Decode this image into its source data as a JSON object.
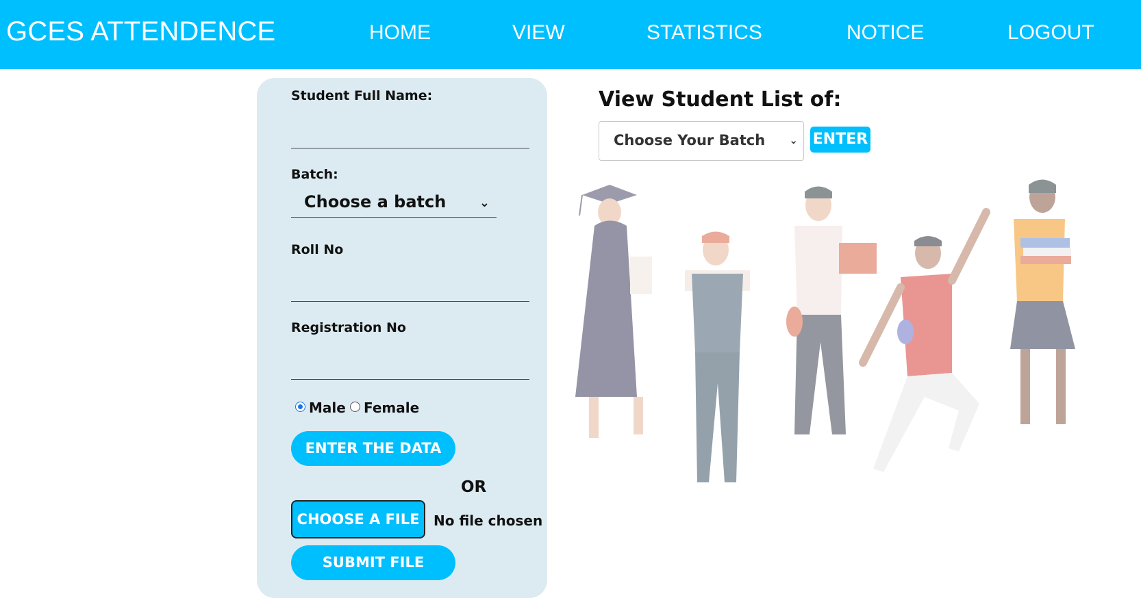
{
  "navbar": {
    "brand": "GCES ATTENDENCE",
    "links": [
      "HOME",
      "VIEW",
      "STATISTICS",
      "NOTICE",
      "LOGOUT"
    ]
  },
  "form": {
    "name_label": "Student Full Name:",
    "name_value": "",
    "batch_label": "Batch:",
    "batch_selected": "Choose a batch",
    "roll_label": "Roll No",
    "roll_value": "",
    "reg_label": "Registration No",
    "reg_value": "",
    "gender_options": [
      "Male",
      "Female"
    ],
    "gender_selected": "Male",
    "enter_button": "ENTER THE DATA",
    "or_text": "OR",
    "file_button": "CHOOSE A FILE",
    "file_status": "No file chosen",
    "submit_button": "SUBMIT FILE"
  },
  "view": {
    "title": "View Student List of:",
    "batch_selected": "Choose Your Batch",
    "enter_button": "ENTER"
  },
  "colors": {
    "accent": "#00bfff",
    "panel": "#dcebf1"
  },
  "icons": {
    "select_arrow": "chevron-down-icon"
  }
}
